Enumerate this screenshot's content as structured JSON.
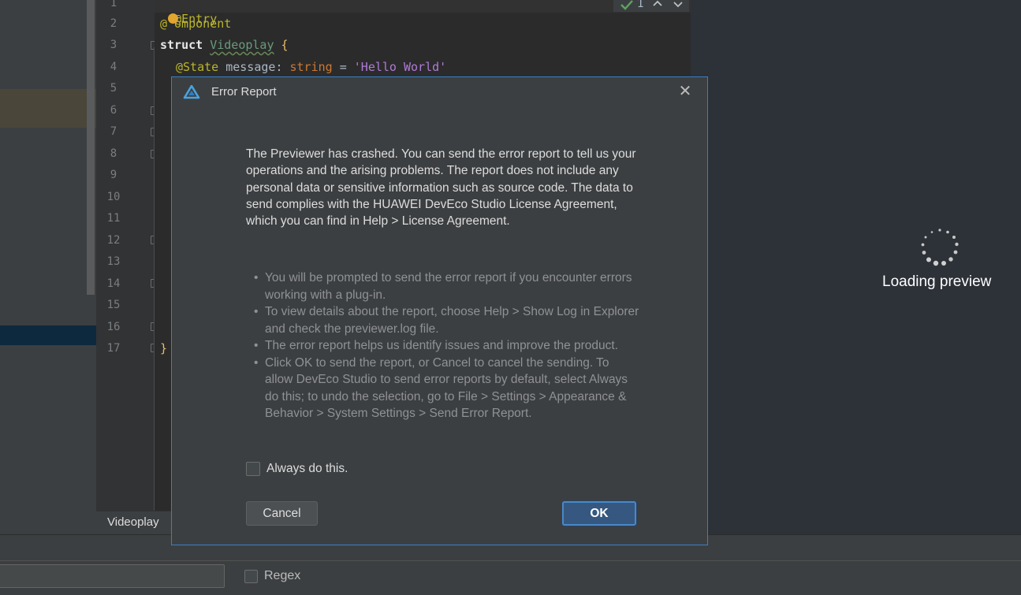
{
  "editor": {
    "line_numbers": [
      "1",
      "2",
      "3",
      "4",
      "5",
      "6",
      "7",
      "8",
      "9",
      "10",
      "11",
      "12",
      "13",
      "14",
      "15",
      "16",
      "17"
    ],
    "code": {
      "line1_annot": "@Entry",
      "line2_annot_prefix": "@",
      "line2_annot_rest": "omponent",
      "line3_kw": "struct",
      "line3_name": "Videoplay",
      "line3_brace": "{",
      "line4_annot": "@State",
      "line4_field": "message",
      "line4_colon": ":",
      "line4_type": "string",
      "line4_eq": "=",
      "line4_str": "'Hello World'",
      "line17_brace": "}"
    },
    "inspections_count": "1",
    "tab_label": "Videoplay"
  },
  "preview": {
    "loading_text": "Loading preview"
  },
  "search": {
    "regex_label": "Regex"
  },
  "dialog": {
    "title": "Error Report",
    "close_glyph": "✕",
    "message": "The Previewer has crashed. You can send the error report to tell us your operations and the arising problems. The report does not include any personal data or sensitive information such as source code. The data to send complies with the HUAWEI DevEco Studio License Agreement, which you can find in Help > License Agreement.",
    "bullets": [
      "You will be prompted to send the error report if you encounter errors working with a plug-in.",
      "To view details about the report, choose Help > Show Log in Explorer and check the previewer.log file.",
      "The error report helps us identify issues and improve the product.",
      "Click OK to send the report, or Cancel to cancel the sending. To allow DevEco Studio to send error reports by default, select Always do this; to undo the selection, go to File > Settings > Appearance & Behavior > System Settings > Send Error Report."
    ],
    "checkbox_label": "Always do this.",
    "cancel_label": "Cancel",
    "ok_label": "OK"
  },
  "colors": {
    "accent": "#3b7fc2",
    "ok_button": "#365880"
  },
  "icons": {
    "logo": "deveco-logo-icon",
    "spinner": "loading-spinner-icon",
    "inspection": "check-icon"
  }
}
